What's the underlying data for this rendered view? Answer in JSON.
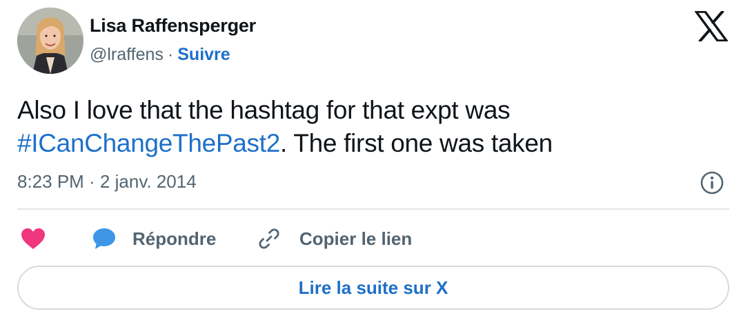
{
  "author": {
    "name": "Lisa Raffensperger",
    "handle": "@lraffens",
    "separator": "·",
    "follow_label": "Suivre"
  },
  "brand": {
    "logo_icon": "x-logo-icon"
  },
  "tweet": {
    "text_line1": "Also I love that the hashtag for that expt was",
    "hashtag": "#ICanChangeThePast2",
    "text_line2_rest": ". The first one was taken",
    "timestamp": "8:23 PM · 2 janv. 2014"
  },
  "actions": {
    "like_icon": "heart-icon",
    "reply_icon": "speech-bubble-icon",
    "reply_label": "Répondre",
    "copy_icon": "link-icon",
    "copy_label": "Copier le lien",
    "info_icon": "info-icon"
  },
  "footer": {
    "read_more_label": "Lire la suite sur X"
  },
  "colors": {
    "link_blue": "#1d70c9",
    "heart_pink": "#f0367d",
    "reply_blue": "#3d97e6",
    "muted_gray": "#536471",
    "text_dark": "#0f1419"
  }
}
